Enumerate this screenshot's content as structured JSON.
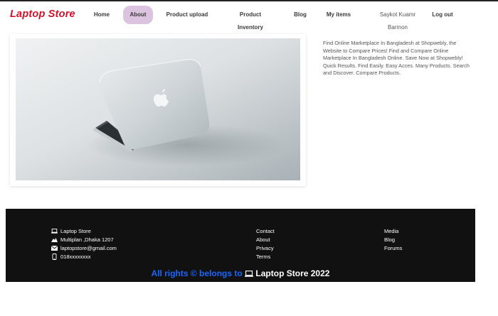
{
  "brand": "Laptop Store",
  "nav": {
    "items": [
      {
        "label": "Home"
      },
      {
        "label": "About"
      },
      {
        "label": "Product upload"
      },
      {
        "label": "Product Inventory"
      },
      {
        "label": "Blog"
      },
      {
        "label": "My items"
      }
    ],
    "active": "About",
    "user": "Saykot Kuamr Barmon",
    "logout": "Log out"
  },
  "hero": {
    "description": "Find Online Marketplace In Bangladesh at Shopwebly, the Website to Compare Prices! Find and Compare Online Marketplace In Bangladesh Online. Save Now at Shopwebly! Quick Results. Find Easily. Easy Acces. Many Products. Search and Discover. Compare Products."
  },
  "footer": {
    "contact": {
      "name": "Laptop Store",
      "address": "Multiplan ,Dhaka 1207",
      "email": "laptopstore@gmail.com",
      "phone": "018xxxxxxxx"
    },
    "links_col1": [
      "Contact",
      "About",
      "Privacy",
      "Terms"
    ],
    "links_col2": [
      "Media",
      "Blog",
      "Forums"
    ],
    "copyright_prefix": "All rights © belongs to",
    "copyright_brand": "Laptop Store 2022"
  },
  "colors": {
    "brand": "#d1102a",
    "nav_active_bg": "#dcc3df",
    "footer_bg": "#111111",
    "copyright_blue": "#1a66ff"
  },
  "icons": {
    "footer_name": "laptop-icon",
    "footer_address": "location-icon",
    "footer_email": "envelope-icon",
    "footer_phone": "phone-icon",
    "copyright": "laptop-icon"
  }
}
